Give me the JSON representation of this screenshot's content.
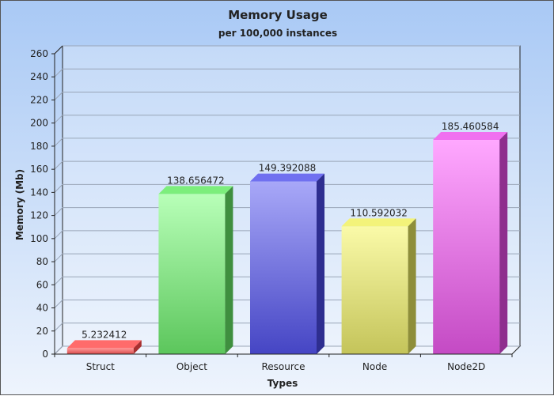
{
  "chart_data": {
    "type": "bar",
    "title": "Memory Usage",
    "subtitle": "per 100,000 instances",
    "xlabel": "Types",
    "ylabel": "Memory (Mb)",
    "ylim": [
      0,
      260
    ],
    "yticks": [
      0,
      20,
      40,
      60,
      80,
      100,
      120,
      140,
      160,
      180,
      200,
      220,
      240,
      260
    ],
    "categories": [
      "Struct",
      "Object",
      "Resource",
      "Node",
      "Node2D"
    ],
    "values": [
      5.232412,
      138.656472,
      149.392088,
      110.592032,
      185.460584
    ],
    "data_labels": [
      "5.232412",
      "138.656472",
      "149.392088",
      "110.592032",
      "185.460584"
    ],
    "grid": true,
    "bar_style": "3d",
    "colors": [
      {
        "light": "#ff9a9a",
        "dark": "#d84a4a",
        "top": "#ff6b6b",
        "side": "#a83030"
      },
      {
        "light": "#b8ffb8",
        "dark": "#5cc65c",
        "top": "#7cee7c",
        "side": "#3f8f3f"
      },
      {
        "light": "#a8a8f8",
        "dark": "#4545c4",
        "top": "#7070f0",
        "side": "#2e2e90"
      },
      {
        "light": "#fafaa8",
        "dark": "#c4c45a",
        "top": "#f3f37a",
        "side": "#8e8e3a"
      },
      {
        "light": "#ffa8ff",
        "dark": "#c44ac4",
        "top": "#f070f0",
        "side": "#8e2e8e"
      }
    ]
  }
}
